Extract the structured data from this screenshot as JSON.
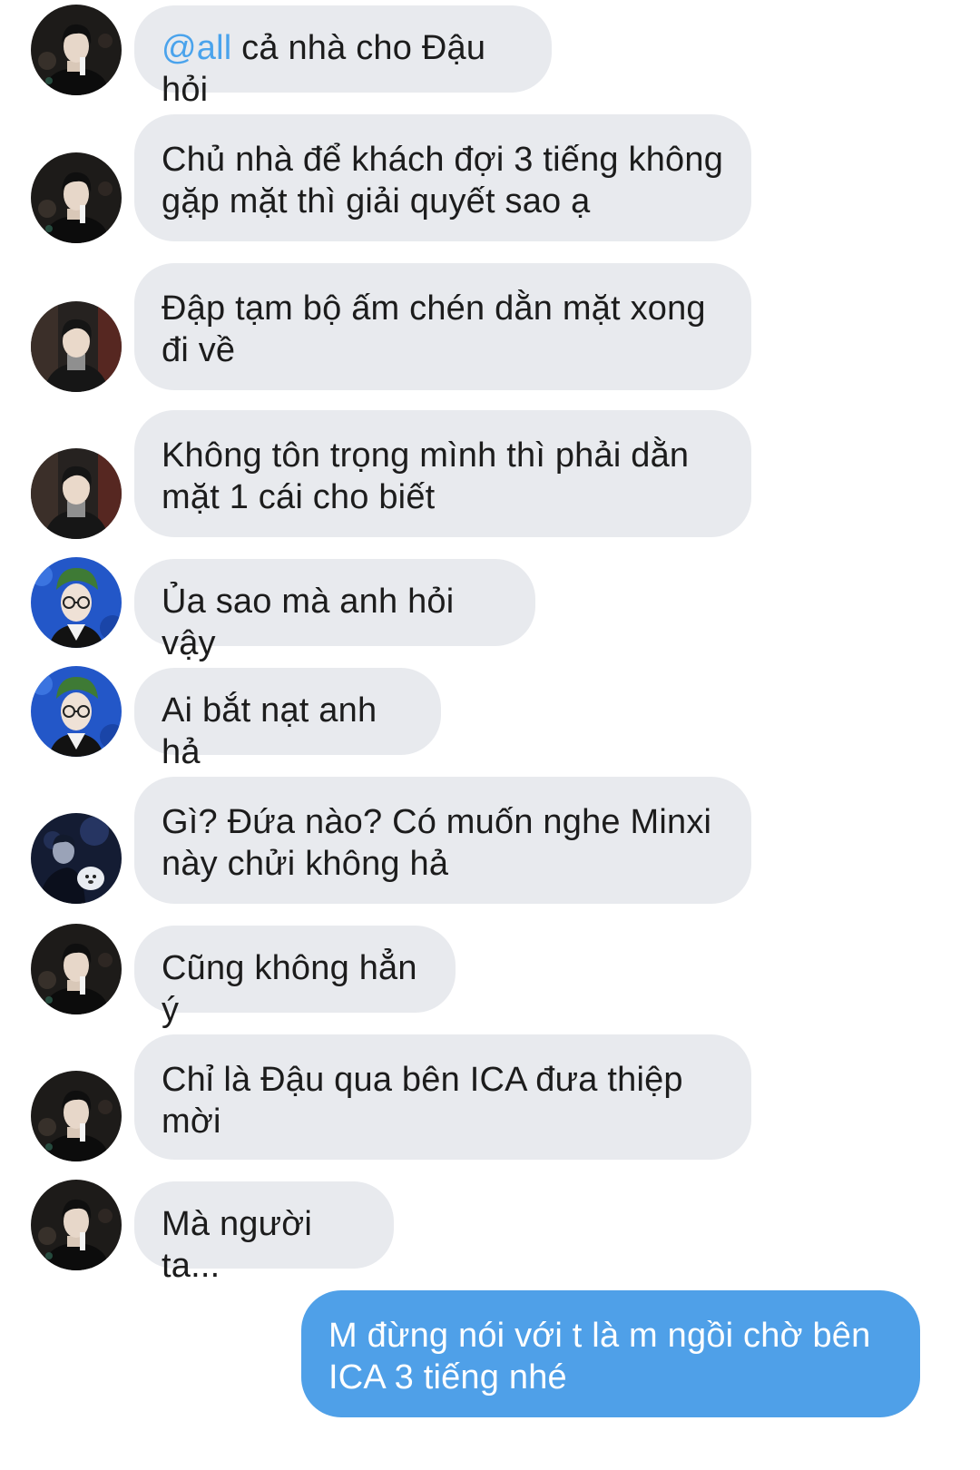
{
  "conversation": {
    "messages": [
      {
        "mention": "@all",
        "text": " cả nhà cho Đậu hỏi",
        "avatar": "avatar-dark-jacket"
      },
      {
        "text": "Chủ nhà để khách đợi 3 tiếng không gặp mặt thì giải quyết sao ạ",
        "avatar": "avatar-dark-jacket"
      },
      {
        "text": "Đập tạm bộ ấm chén dằn mặt xong đi về",
        "avatar": "avatar-grey-turtleneck"
      },
      {
        "text": "Không tôn trọng mình thì phải dằn mặt 1 cái cho biết",
        "avatar": "avatar-grey-turtleneck"
      },
      {
        "text": "Ủa sao mà anh hỏi vậy",
        "avatar": "avatar-blue-glasses"
      },
      {
        "text": "Ai bắt nạt anh hả",
        "avatar": "avatar-blue-glasses"
      },
      {
        "text": "Gì? Đứa nào? Có muốn nghe Minxi này chửi không hả",
        "avatar": "avatar-concert-dog"
      },
      {
        "text": "Cũng không hẳn ý",
        "avatar": "avatar-dark-jacket"
      },
      {
        "text": "Chỉ là Đậu qua bên ICA đưa thiệp mời",
        "avatar": "avatar-dark-jacket"
      },
      {
        "text": "Mà người ta...",
        "avatar": "avatar-dark-jacket"
      }
    ],
    "sent": {
      "text": "M đừng nói với t là m ngồi chờ bên ICA 3 tiếng nhé"
    }
  },
  "colors": {
    "received_bubble": "#e8eaee",
    "sent_bubble": "#4fa0e8",
    "mention": "#4aa3ec",
    "text": "#1c1c1c"
  }
}
